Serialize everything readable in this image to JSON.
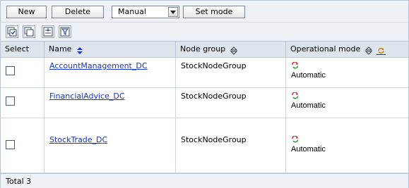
{
  "toolbar": {
    "new_label": "New",
    "delete_label": "Delete",
    "mode_select_value": "Manual",
    "set_mode_label": "Set mode"
  },
  "icons": [
    "select-all-icon",
    "deselect-all-icon",
    "expand-icon",
    "filter-icon"
  ],
  "table": {
    "headers": {
      "select": "Select",
      "name": "Name",
      "node_group": "Node group",
      "operational_mode": "Operational mode"
    },
    "rows": [
      {
        "name": "AccountManagement_DC",
        "node_group": "StockNodeGroup",
        "mode": "Automatic"
      },
      {
        "name": "FinancialAdvice_DC",
        "node_group": "StockNodeGroup",
        "mode": "Automatic"
      },
      {
        "name": "StockTrade_DC",
        "node_group": "StockNodeGroup",
        "mode": "Automatic"
      }
    ]
  },
  "footer": {
    "total": "Total 3"
  },
  "colors": {
    "link": "#1a35c9",
    "header_bg": "#dfe5ed",
    "toolbar_bg": "#eef2f7"
  }
}
